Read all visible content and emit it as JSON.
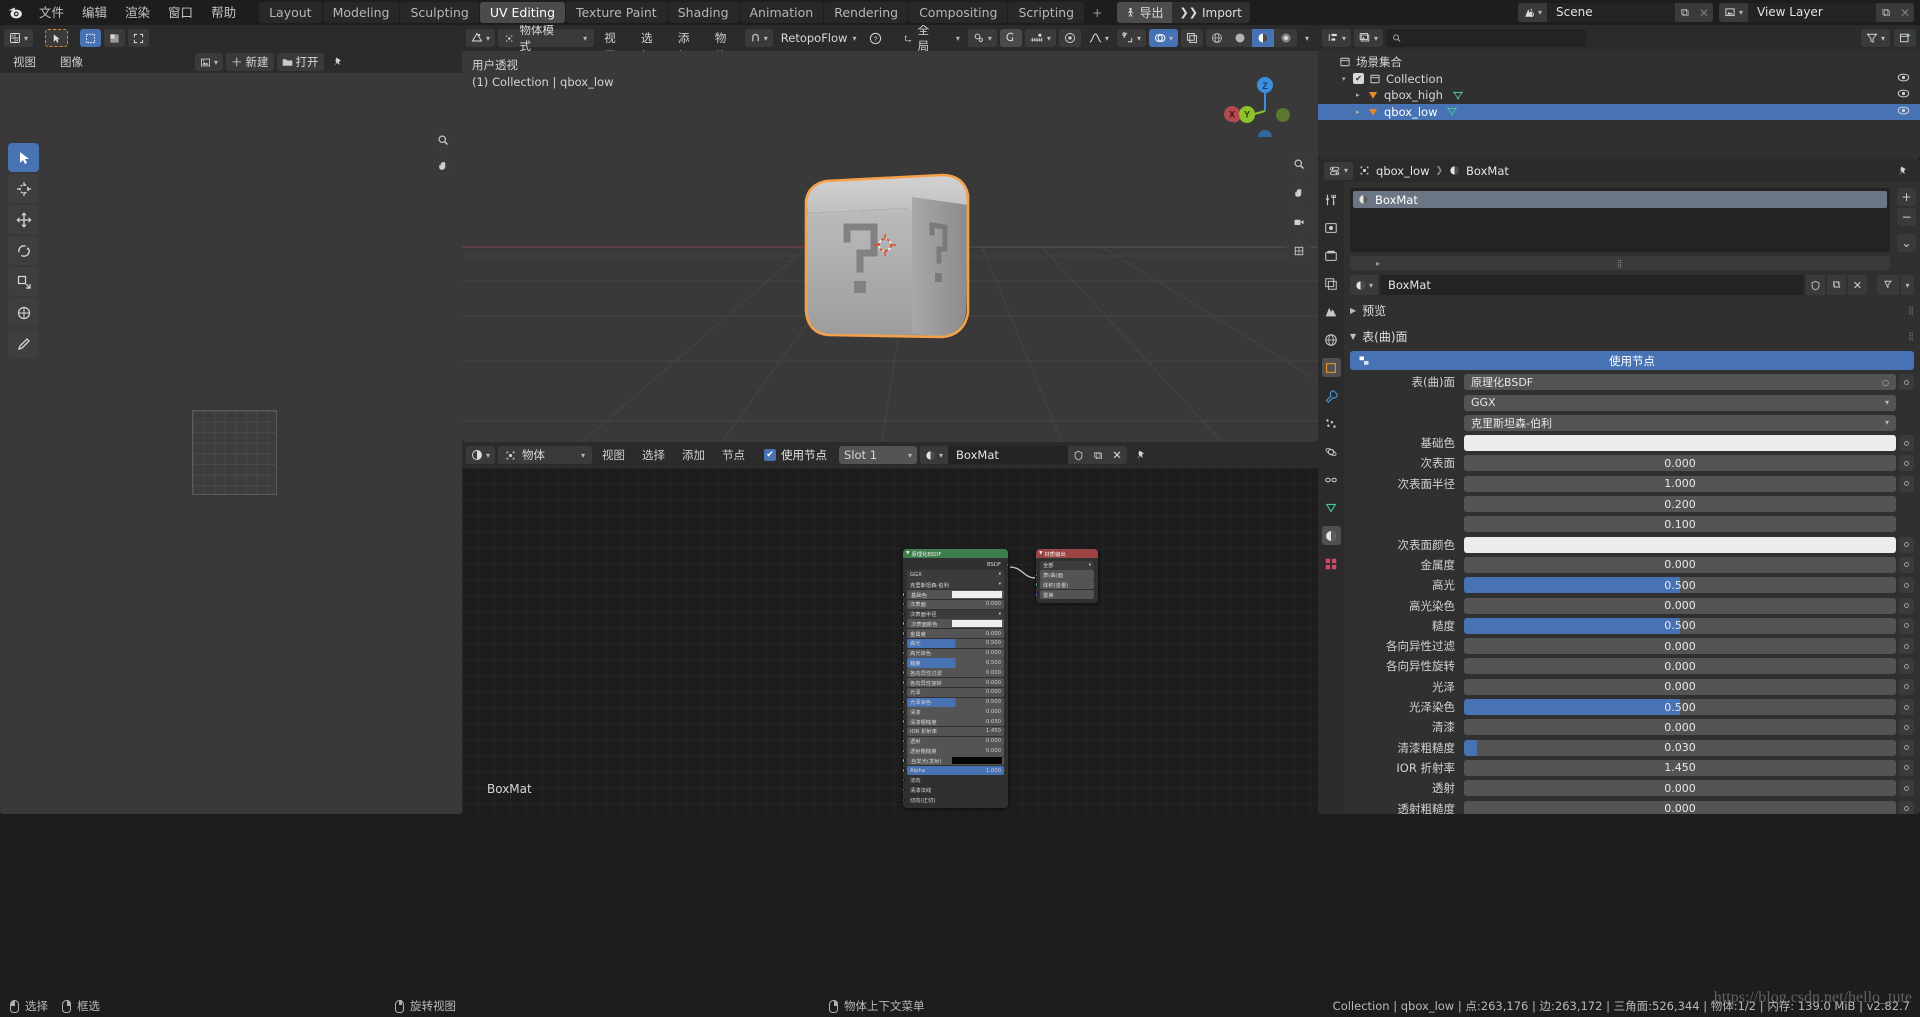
{
  "topbar": {
    "app_icon": "blender-logo",
    "menus": [
      "文件",
      "编辑",
      "渲染",
      "窗口",
      "帮助"
    ],
    "workspace_tabs": [
      {
        "label": "Layout",
        "active": false
      },
      {
        "label": "Modeling",
        "active": false
      },
      {
        "label": "Sculpting",
        "active": false
      },
      {
        "label": "UV Editing",
        "active": true
      },
      {
        "label": "Texture Paint",
        "active": false
      },
      {
        "label": "Shading",
        "active": false
      },
      {
        "label": "Animation",
        "active": false
      },
      {
        "label": "Rendering",
        "active": false
      },
      {
        "label": "Compositing",
        "active": false
      },
      {
        "label": "Scripting",
        "active": false
      }
    ],
    "add_tab": "+",
    "addon_export": "导出",
    "addon_import": "Import",
    "scene_name": "Scene",
    "viewlayer_name": "View Layer",
    "scene_icon": "scene-icon",
    "viewlayer_icon": "view-layer-icon",
    "copy_icon": "copy-icon",
    "close_icon": "close-icon"
  },
  "uv_editor": {
    "editor_type_icon": "uv-editor-icon",
    "cursor_tool_icon": "tweak-cursor-icon",
    "select_modes": [
      "select-box-icon",
      "select-face-icon",
      "select-island-icon"
    ],
    "menus": [
      "视图",
      "图像"
    ],
    "image_icon": "image-icon",
    "new_label": "新建",
    "open_label": "打开",
    "pin_icon": "pin-icon",
    "tools": [
      {
        "name": "tweak-tool",
        "active": true
      },
      {
        "name": "cursor-tool",
        "active": false
      },
      {
        "name": "move-tool",
        "active": false
      },
      {
        "name": "rotate-tool",
        "active": false
      },
      {
        "name": "scale-tool",
        "active": false
      },
      {
        "name": "transform-tool",
        "active": false
      },
      {
        "name": "annotate-tool",
        "active": false
      }
    ],
    "zoom_icon": "zoom-icon",
    "pan_icon": "pan-hand-icon"
  },
  "viewport": {
    "editor_type_icon": "viewport-icon",
    "mode": "物体模式",
    "menus": [
      "视图",
      "选择",
      "添加",
      "物体"
    ],
    "snap_dropdown_icon": "magnet-icon",
    "addon_menu": "RetopoFlow",
    "help_icon": "question-icon",
    "orientation": "全局",
    "pivot_icon": "pivot-icon",
    "snap_icon": "snap-icon",
    "proportional_icon": "proportional-edit-icon",
    "falloff_icon": "falloff-curve-icon",
    "overlay_icons": [
      "gizmo-icon",
      "overlays-icon",
      "xray-icon"
    ],
    "shading_modes": [
      "wireframe-icon",
      "solid-icon",
      "material-preview-icon",
      "rendered-icon"
    ],
    "perspective_label": "用户透视",
    "collection_label": "(1) Collection | qbox_low",
    "gizmo_axes": [
      {
        "label": "Z",
        "color": "#3b8ee0"
      },
      {
        "label": "Y",
        "color": "#8ec12c"
      },
      {
        "label": "X",
        "color": "#b34a4f"
      }
    ],
    "selected_outline_color": "#f5a04b"
  },
  "shader_editor": {
    "editor_type_icon": "shader-editor-icon",
    "shader_type": "物体",
    "menus": [
      "视图",
      "选择",
      "添加",
      "节点"
    ],
    "use_nodes_label": "使用节点",
    "use_nodes_checked": true,
    "slot_label": "Slot 1",
    "material_icon": "material-icon",
    "material_name": "BoxMat",
    "shield_icon": "fake-user-icon",
    "copy_icon": "copy-icon",
    "close_icon": "close-icon",
    "pin_icon": "pin-icon",
    "footer_label": "BoxMat",
    "nodes": [
      {
        "title": "原理化BSDF",
        "header_color": "#3d7e4c",
        "output_socket": "BSDF",
        "dropdowns": [
          "GGX",
          "克里斯坦森-伯利"
        ],
        "inputs": [
          {
            "label": "基础色",
            "type": "color",
            "value": "#ececec",
            "socket": "#cccc33"
          },
          {
            "label": "次表面",
            "type": "value",
            "value": "0.000",
            "socket": "#9a9a9a"
          },
          {
            "label": "次表面半径",
            "type": "dropdown",
            "value": "",
            "socket": "#6363c7"
          },
          {
            "label": "次表面颜色",
            "type": "color",
            "value": "#ececec",
            "socket": "#cccc33"
          },
          {
            "label": "金属度",
            "type": "value",
            "value": "0.000",
            "socket": "#9a9a9a"
          },
          {
            "label": "高光",
            "type": "slider",
            "value": "0.500",
            "fill": 50,
            "socket": "#9a9a9a"
          },
          {
            "label": "高光染色",
            "type": "value",
            "value": "0.000",
            "socket": "#9a9a9a"
          },
          {
            "label": "糙度",
            "type": "slider",
            "value": "0.500",
            "fill": 50,
            "socket": "#9a9a9a"
          },
          {
            "label": "各向异性过滤",
            "type": "value",
            "value": "0.000",
            "socket": "#9a9a9a"
          },
          {
            "label": "各向异性旋转",
            "type": "value",
            "value": "0.000",
            "socket": "#9a9a9a"
          },
          {
            "label": "光泽",
            "type": "value",
            "value": "0.000",
            "socket": "#9a9a9a"
          },
          {
            "label": "光泽染色",
            "type": "slider",
            "value": "0.500",
            "fill": 50,
            "socket": "#9a9a9a"
          },
          {
            "label": "清漆",
            "type": "value",
            "value": "0.000",
            "socket": "#9a9a9a"
          },
          {
            "label": "清漆粗糙度",
            "type": "value",
            "value": "0.030",
            "socket": "#9a9a9a"
          },
          {
            "label": "IOR 折射率",
            "type": "value",
            "value": "1.450",
            "socket": "#9a9a9a"
          },
          {
            "label": "透射",
            "type": "value",
            "value": "0.000",
            "socket": "#9a9a9a"
          },
          {
            "label": "透射粗糙度",
            "type": "value",
            "value": "0.000",
            "socket": "#9a9a9a"
          },
          {
            "label": "自发光(发射)",
            "type": "color",
            "value": "#050505",
            "socket": "#cccc33"
          },
          {
            "label": "Alpha",
            "type": "slider",
            "value": "1.000",
            "fill": 100,
            "socket": "#9a9a9a"
          },
          {
            "label": "法向",
            "type": "plain",
            "value": "",
            "socket": "#6363c7"
          },
          {
            "label": "清漆法线",
            "type": "plain",
            "value": "",
            "socket": "#6363c7"
          },
          {
            "label": "切向(正切)",
            "type": "plain",
            "value": "",
            "socket": "#6363c7"
          }
        ]
      },
      {
        "title": "材质输出",
        "header_color": "#9c4343",
        "dropdowns": [
          "全部"
        ],
        "inputs": [
          {
            "label": "表(曲)面",
            "socket": "#5dbb5d"
          },
          {
            "label": "体积(音量)",
            "socket": "#5dbb5d"
          },
          {
            "label": "置换",
            "socket": "#6363c7"
          }
        ]
      }
    ]
  },
  "outliner": {
    "display_mode_icon": "outliner-display-icon",
    "filter_id_icon": "id-type-icon",
    "search_icon": "search-icon",
    "search_placeholder": "",
    "filter_icon": "filter-funnel-icon",
    "new_collection_icon": "new-collection-icon",
    "rows": [
      {
        "label": "场景集合",
        "indent": 0,
        "icon": "collection-icon",
        "selected": false,
        "has_eye": false,
        "has_check": false,
        "expand": ""
      },
      {
        "label": "Collection",
        "indent": 1,
        "icon": "collection-icon",
        "selected": false,
        "has_eye": true,
        "has_check": true,
        "expand": "▾"
      },
      {
        "label": "qbox_high",
        "indent": 2,
        "icon": "mesh-object-icon",
        "selected": false,
        "has_eye": true,
        "has_check": false,
        "expand": "▸"
      },
      {
        "label": "qbox_low",
        "indent": 2,
        "icon": "mesh-object-icon",
        "selected": true,
        "has_eye": true,
        "has_check": false,
        "expand": "▸"
      }
    ]
  },
  "properties": {
    "editor_icon": "properties-editor-icon",
    "breadcrumb": [
      "qbox_low",
      "BoxMat"
    ],
    "object_icon": "object-icon",
    "material_icon": "material-icon",
    "pin_icon": "pin-icon",
    "tabs": [
      {
        "name": "tool-tab",
        "glyph": "tool",
        "active": false
      },
      {
        "name": "render-tab",
        "glyph": "render",
        "active": false
      },
      {
        "name": "output-tab",
        "glyph": "output",
        "active": false
      },
      {
        "name": "viewlayer-tab",
        "glyph": "viewlayer",
        "active": false
      },
      {
        "name": "scene-tab",
        "glyph": "scene",
        "active": false
      },
      {
        "name": "world-tab",
        "glyph": "world",
        "active": false
      },
      {
        "name": "object-tab",
        "glyph": "object",
        "active": true
      },
      {
        "name": "modifier-tab",
        "glyph": "wrench",
        "active": false
      },
      {
        "name": "particles-tab",
        "glyph": "particles",
        "active": false
      },
      {
        "name": "physics-tab",
        "glyph": "physics",
        "active": false
      },
      {
        "name": "constraints-tab",
        "glyph": "constraint",
        "active": false
      },
      {
        "name": "data-tab",
        "glyph": "data",
        "active": false
      },
      {
        "name": "material-tab",
        "glyph": "material",
        "active": true
      },
      {
        "name": "texture-tab",
        "glyph": "texture",
        "active": false
      }
    ],
    "slot_list": [
      {
        "label": "BoxMat",
        "selected": true
      }
    ],
    "slot_buttons": [
      "+",
      "−",
      "⌄"
    ],
    "material_name": "BoxMat",
    "fake_user_icon": "fake-user-icon",
    "copy_icon": "copy-icon",
    "close_icon": "close-icon",
    "node_filter_icon": "node-filter-icon",
    "preview_panel": "预览",
    "surface_panel": "表(曲)面",
    "use_nodes_label": "使用节点",
    "rows": [
      {
        "label": "表(曲)面",
        "type": "dropdown",
        "value": "原理化BSDF",
        "dot": true
      },
      {
        "label": "",
        "type": "dropdown",
        "value": "GGX",
        "dot": false
      },
      {
        "label": "",
        "type": "dropdown",
        "value": "克里斯坦森-伯利",
        "dot": false
      },
      {
        "label": "基础色",
        "type": "color",
        "value": "",
        "dot": true
      },
      {
        "label": "次表面",
        "type": "value",
        "value": "0.000",
        "dot": true
      },
      {
        "label": "次表面半径",
        "type": "value",
        "value": "1.000",
        "dot": true
      },
      {
        "label": "",
        "type": "value",
        "value": "0.200",
        "dot": false
      },
      {
        "label": "",
        "type": "value",
        "value": "0.100",
        "dot": false
      },
      {
        "label": "次表面颜色",
        "type": "color",
        "value": "",
        "dot": true
      },
      {
        "label": "金属度",
        "type": "value",
        "value": "0.000",
        "dot": true
      },
      {
        "label": "高光",
        "type": "slider",
        "value": "0.500",
        "fill": 50,
        "dot": true
      },
      {
        "label": "高光染色",
        "type": "value",
        "value": "0.000",
        "dot": true
      },
      {
        "label": "糙度",
        "type": "slider",
        "value": "0.500",
        "fill": 50,
        "dot": true
      },
      {
        "label": "各向异性过滤",
        "type": "value",
        "value": "0.000",
        "dot": true
      },
      {
        "label": "各向异性旋转",
        "type": "value",
        "value": "0.000",
        "dot": true
      },
      {
        "label": "光泽",
        "type": "value",
        "value": "0.000",
        "dot": true
      },
      {
        "label": "光泽染色",
        "type": "slider",
        "value": "0.500",
        "fill": 50,
        "dot": true
      },
      {
        "label": "清漆",
        "type": "value",
        "value": "0.000",
        "dot": true
      },
      {
        "label": "清漆粗糙度",
        "type": "slider",
        "value": "0.030",
        "fill": 3,
        "dot": true
      },
      {
        "label": "IOR 折射率",
        "type": "value",
        "value": "1.450",
        "dot": true
      },
      {
        "label": "透射",
        "type": "value",
        "value": "0.000",
        "dot": true
      },
      {
        "label": "透射粗糙度",
        "type": "value",
        "value": "0.000",
        "dot": true
      }
    ]
  },
  "statusbar": {
    "hints": [
      {
        "mouse": "l",
        "label": "选择"
      },
      {
        "mouse": "r",
        "label": "框选"
      },
      {
        "mouse": "m",
        "label": "旋转视图"
      },
      {
        "mouse": "r",
        "label": "物体上下文菜单"
      }
    ],
    "stats": "Collection | qbox_low | 点:263,176 | 边:263,172 | 三角面:526,344 | 物体:1/2 | 内存: 139.0 MiB | v2.82.7",
    "watermark": "https://blog.csdn.net/hello_tute"
  }
}
